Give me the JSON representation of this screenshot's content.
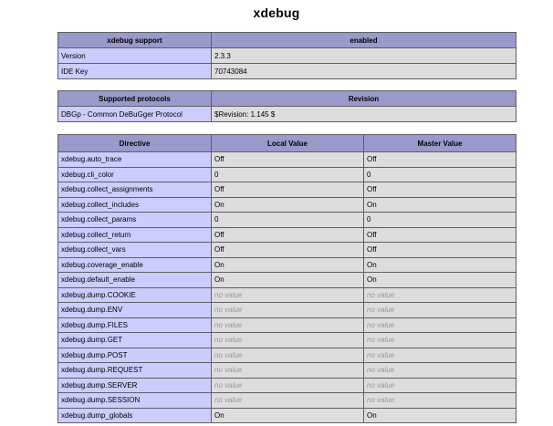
{
  "page_title": "xdebug",
  "support_table": {
    "header": [
      "xdebug support",
      "enabled"
    ],
    "rows": [
      [
        "Version",
        "2.3.3"
      ],
      [
        "IDE Key",
        "70743084"
      ]
    ]
  },
  "protocols_table": {
    "header": [
      "Supported protocols",
      "Revision"
    ],
    "rows": [
      [
        "DBGp - Common DeBuGger Protocol",
        "$Revision: 1.145 $"
      ]
    ]
  },
  "directives_table": {
    "header": [
      "Directive",
      "Local Value",
      "Master Value"
    ],
    "rows": [
      [
        "xdebug.auto_trace",
        "Off",
        "Off"
      ],
      [
        "xdebug.cli_color",
        "0",
        "0"
      ],
      [
        "xdebug.collect_assignments",
        "Off",
        "Off"
      ],
      [
        "xdebug.collect_includes",
        "On",
        "On"
      ],
      [
        "xdebug.collect_params",
        "0",
        "0"
      ],
      [
        "xdebug.collect_return",
        "Off",
        "Off"
      ],
      [
        "xdebug.collect_vars",
        "Off",
        "Off"
      ],
      [
        "xdebug.coverage_enable",
        "On",
        "On"
      ],
      [
        "xdebug.default_enable",
        "On",
        "On"
      ],
      [
        "xdebug.dump.COOKIE",
        "no value",
        "no value"
      ],
      [
        "xdebug.dump.ENV",
        "no value",
        "no value"
      ],
      [
        "xdebug.dump.FILES",
        "no value",
        "no value"
      ],
      [
        "xdebug.dump.GET",
        "no value",
        "no value"
      ],
      [
        "xdebug.dump.POST",
        "no value",
        "no value"
      ],
      [
        "xdebug.dump.REQUEST",
        "no value",
        "no value"
      ],
      [
        "xdebug.dump.SERVER",
        "no value",
        "no value"
      ],
      [
        "xdebug.dump.SESSION",
        "no value",
        "no value"
      ],
      [
        "xdebug.dump_globals",
        "On",
        "On"
      ]
    ]
  },
  "colors": {
    "header_bg": "#9999cc",
    "directive_bg": "#ccccff",
    "value_bg": "#dddddd",
    "no_value_text": "#999999"
  }
}
